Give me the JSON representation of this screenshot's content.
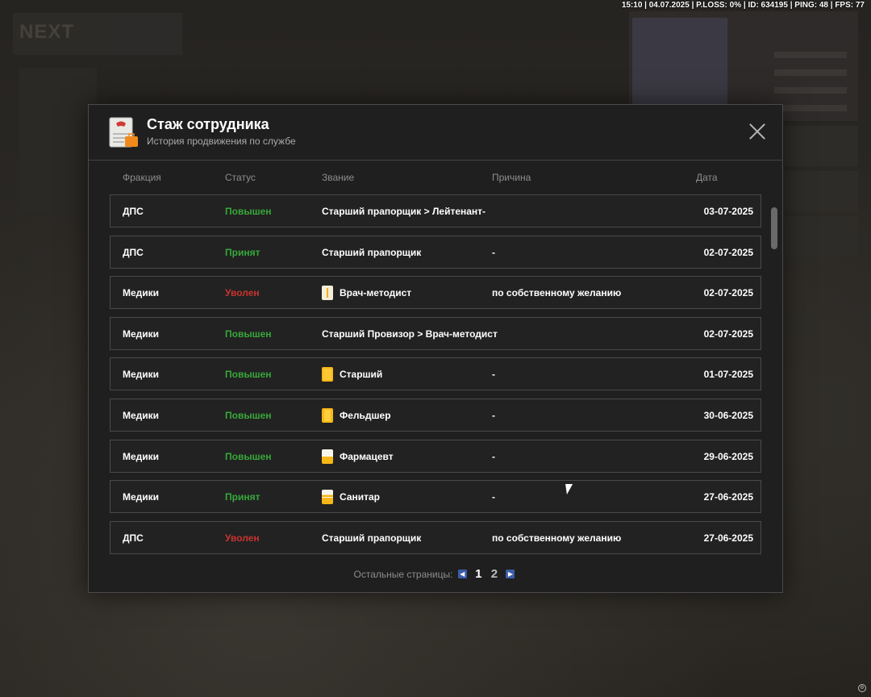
{
  "top_status": "15:10 | 04.07.2025 | P.LOSS: 0% | ID: 634195 | PING: 48 | FPS: 77",
  "modal": {
    "title": "Стаж сотрудника",
    "subtitle": "История продвижения по службе",
    "columns": {
      "faction": "Фракция",
      "status": "Статус",
      "rank": "Звание",
      "reason": "Причина",
      "date": "Дата"
    },
    "rows": [
      {
        "faction": "ДПС",
        "status": "Повышен",
        "status_kind": "up",
        "rank_icon": "",
        "rank": "Старший прапорщик > Лейтенант",
        "reason": "-",
        "date": "03-07-2025"
      },
      {
        "faction": "ДПС",
        "status": "Принят",
        "status_kind": "in",
        "rank_icon": "",
        "rank": "Старший прапорщик",
        "reason": "-",
        "date": "02-07-2025"
      },
      {
        "faction": "Медики",
        "status": "Уволен",
        "status_kind": "out",
        "rank_icon": "doctor-rank-icon",
        "rank": "Врач-методист",
        "reason": "по собственному желанию",
        "date": "02-07-2025"
      },
      {
        "faction": "Медики",
        "status": "Повышен",
        "status_kind": "up",
        "rank_icon": "",
        "rank": "Старший Провизор > Врач-методист",
        "reason": "",
        "date": "02-07-2025"
      },
      {
        "faction": "Медики",
        "status": "Повышен",
        "status_kind": "up",
        "rank_icon": "senior-rank-icon",
        "rank": "Старший",
        "reason": "-",
        "date": "01-07-2025"
      },
      {
        "faction": "Медики",
        "status": "Повышен",
        "status_kind": "up",
        "rank_icon": "feldsher-rank-icon",
        "rank": "Фельдшер",
        "reason": "-",
        "date": "30-06-2025"
      },
      {
        "faction": "Медики",
        "status": "Повышен",
        "status_kind": "up",
        "rank_icon": "pharmacist-rank-icon",
        "rank": "Фармацевт",
        "reason": "-",
        "date": "29-06-2025"
      },
      {
        "faction": "Медики",
        "status": "Принят",
        "status_kind": "in",
        "rank_icon": "orderly-rank-icon",
        "rank": "Санитар",
        "reason": "-",
        "date": "27-06-2025"
      },
      {
        "faction": "ДПС",
        "status": "Уволен",
        "status_kind": "out",
        "rank_icon": "",
        "rank": "Старший прапорщик",
        "reason": "по собственному желанию",
        "date": "27-06-2025"
      }
    ],
    "pagination": {
      "label": "Остальные страницы:",
      "pages": [
        "1",
        "2"
      ],
      "current": "1"
    }
  },
  "colors": {
    "promoted": "#37a83a",
    "hired": "#37a83a",
    "fired": "#c7342f",
    "pager_arrow": "#3c5ca8"
  }
}
